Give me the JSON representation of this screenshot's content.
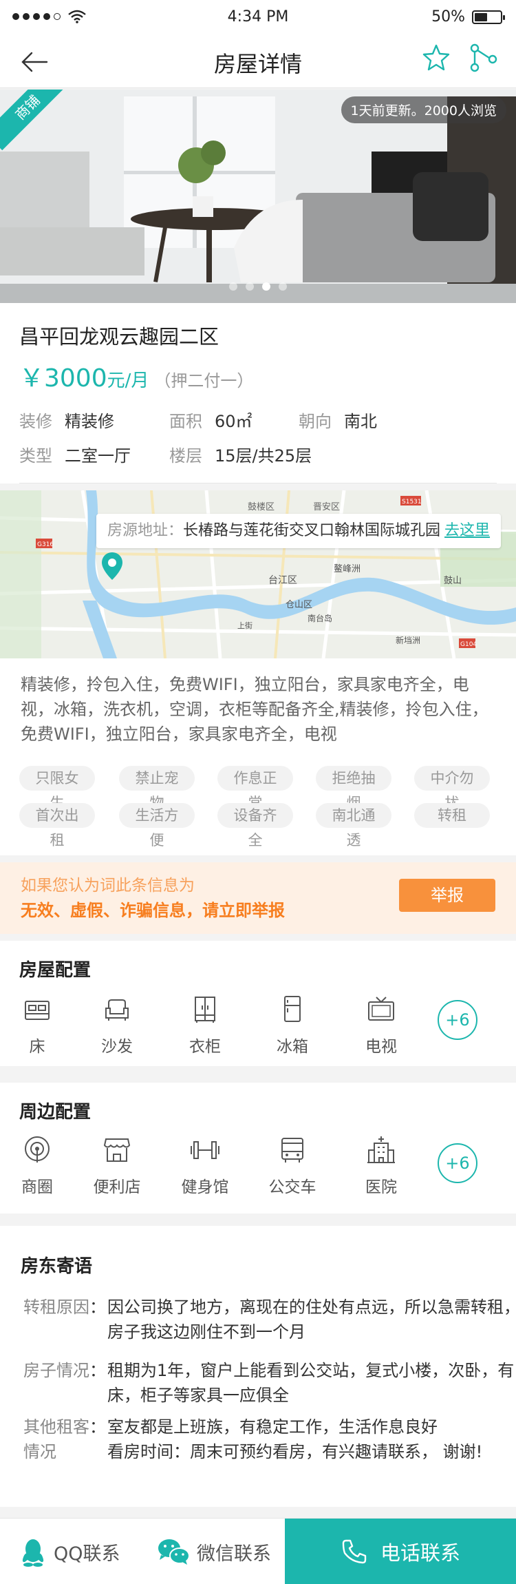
{
  "status_bar": {
    "time": "4:34 PM",
    "battery": "50%",
    "battery_level": 0.5
  },
  "nav": {
    "title": "房屋详情",
    "icons": [
      "back-arrow-icon",
      "star-icon",
      "share-icon"
    ]
  },
  "hero": {
    "ribbon": "商铺",
    "update_text": "1天前更新。2000人浏览",
    "slides": 4,
    "active_slide": 2
  },
  "listing": {
    "name": "昌平回龙观云趣园二区",
    "price": "￥3000",
    "price_unit": "元/月",
    "deposit": "（押二付一）",
    "attrs": [
      {
        "key": "装修",
        "value": "精装修"
      },
      {
        "key": "面积",
        "value": "60㎡"
      },
      {
        "key": "朝向",
        "value": "南北"
      },
      {
        "key": "类型",
        "value": "二室一厅"
      },
      {
        "key": "楼层",
        "value": "15层/共25层"
      }
    ]
  },
  "map": {
    "addr_label": "房源地址：",
    "addr_value": "长椿路与莲花街交叉口翰林国际城孔园",
    "go_label": "去这里",
    "place_labels": [
      "鼓楼区",
      "晋安区",
      "台江区",
      "鳌峰洲",
      "仓山区",
      "南台岛",
      "新垱洲",
      "鼓山",
      "上街",
      "S1531",
      "G316",
      "G104"
    ]
  },
  "description": {
    "text": "精装修，拎包入住，免费WIFI，独立阳台，家具家电齐全，电视，冰箱，洗衣机，空调，衣柜等配备齐全,精装修，拎包入住，免费WIFI，独立阳台，家具家电齐全，电视",
    "tags": [
      "只限女生",
      "禁止宠物",
      "作息正常",
      "拒绝抽烟",
      "中介勿扰",
      "首次出租",
      "生活方便",
      "设备齐全",
      "南北通透",
      "转租"
    ]
  },
  "report": {
    "line1": "如果您认为词此条信息为",
    "line2": "无效、虚假、诈骗信息，请立即举报",
    "button": "举报"
  },
  "facilities": {
    "title": "房屋配置",
    "items": [
      {
        "label": "床",
        "icon": "bed-icon"
      },
      {
        "label": "沙发",
        "icon": "sofa-icon"
      },
      {
        "label": "衣柜",
        "icon": "wardrobe-icon"
      },
      {
        "label": "冰箱",
        "icon": "fridge-icon"
      },
      {
        "label": "电视",
        "icon": "tv-icon"
      }
    ],
    "more": "+6"
  },
  "nearby": {
    "title": "周边配置",
    "items": [
      {
        "label": "商圈",
        "icon": "business-district-icon"
      },
      {
        "label": "便利店",
        "icon": "store-icon"
      },
      {
        "label": "健身馆",
        "icon": "gym-icon"
      },
      {
        "label": "公交车",
        "icon": "bus-icon"
      },
      {
        "label": "医院",
        "icon": "hospital-icon"
      }
    ],
    "more": "+6"
  },
  "landlord": {
    "title": "房东寄语",
    "rows": [
      {
        "key": "转租原因",
        "value": "因公司换了地方，离现在的住处有点远，所以急需转租，房子我这边刚住不到一个月"
      },
      {
        "key": "房子情况",
        "value": "租期为1年，窗户上能看到公交站，复式小楼，次卧，有床，柜子等家具一应俱全"
      },
      {
        "key": "其他租客情况",
        "value": "室友都是上班族，有稳定工作，生活作息良好\n看房时间：周末可预约看房，有兴趣请联系， 谢谢!"
      }
    ]
  },
  "bottom_bar": {
    "qq": "QQ联系",
    "wechat": "微信联系",
    "call": "电话联系"
  },
  "colors": {
    "accent": "#1cb6ad",
    "warn": "#f8913c",
    "warn_bg": "#fef0e4"
  }
}
